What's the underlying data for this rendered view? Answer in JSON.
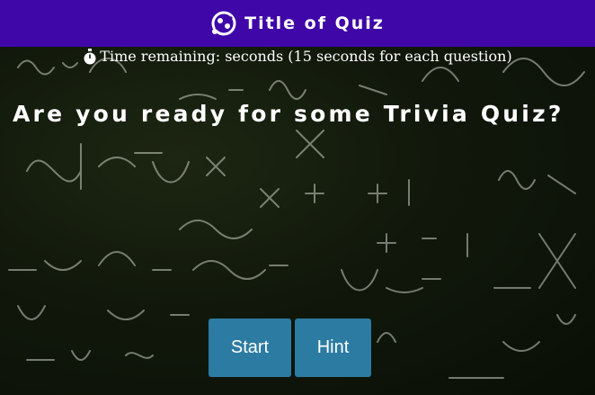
{
  "navbar": {
    "title": "Title of Quiz",
    "icon": "quiz-logo-icon",
    "color": "#3f07a8"
  },
  "timer": {
    "icon": "stopwatch-icon",
    "text": "Time remaining: seconds (15 seconds for each question)"
  },
  "main": {
    "headline": "Are you ready for some Trivia Quiz?",
    "background": "chalkboard-with-math-equations"
  },
  "buttons": {
    "start_label": "Start",
    "hint_label": "Hint",
    "color": "#2c7ba2"
  }
}
